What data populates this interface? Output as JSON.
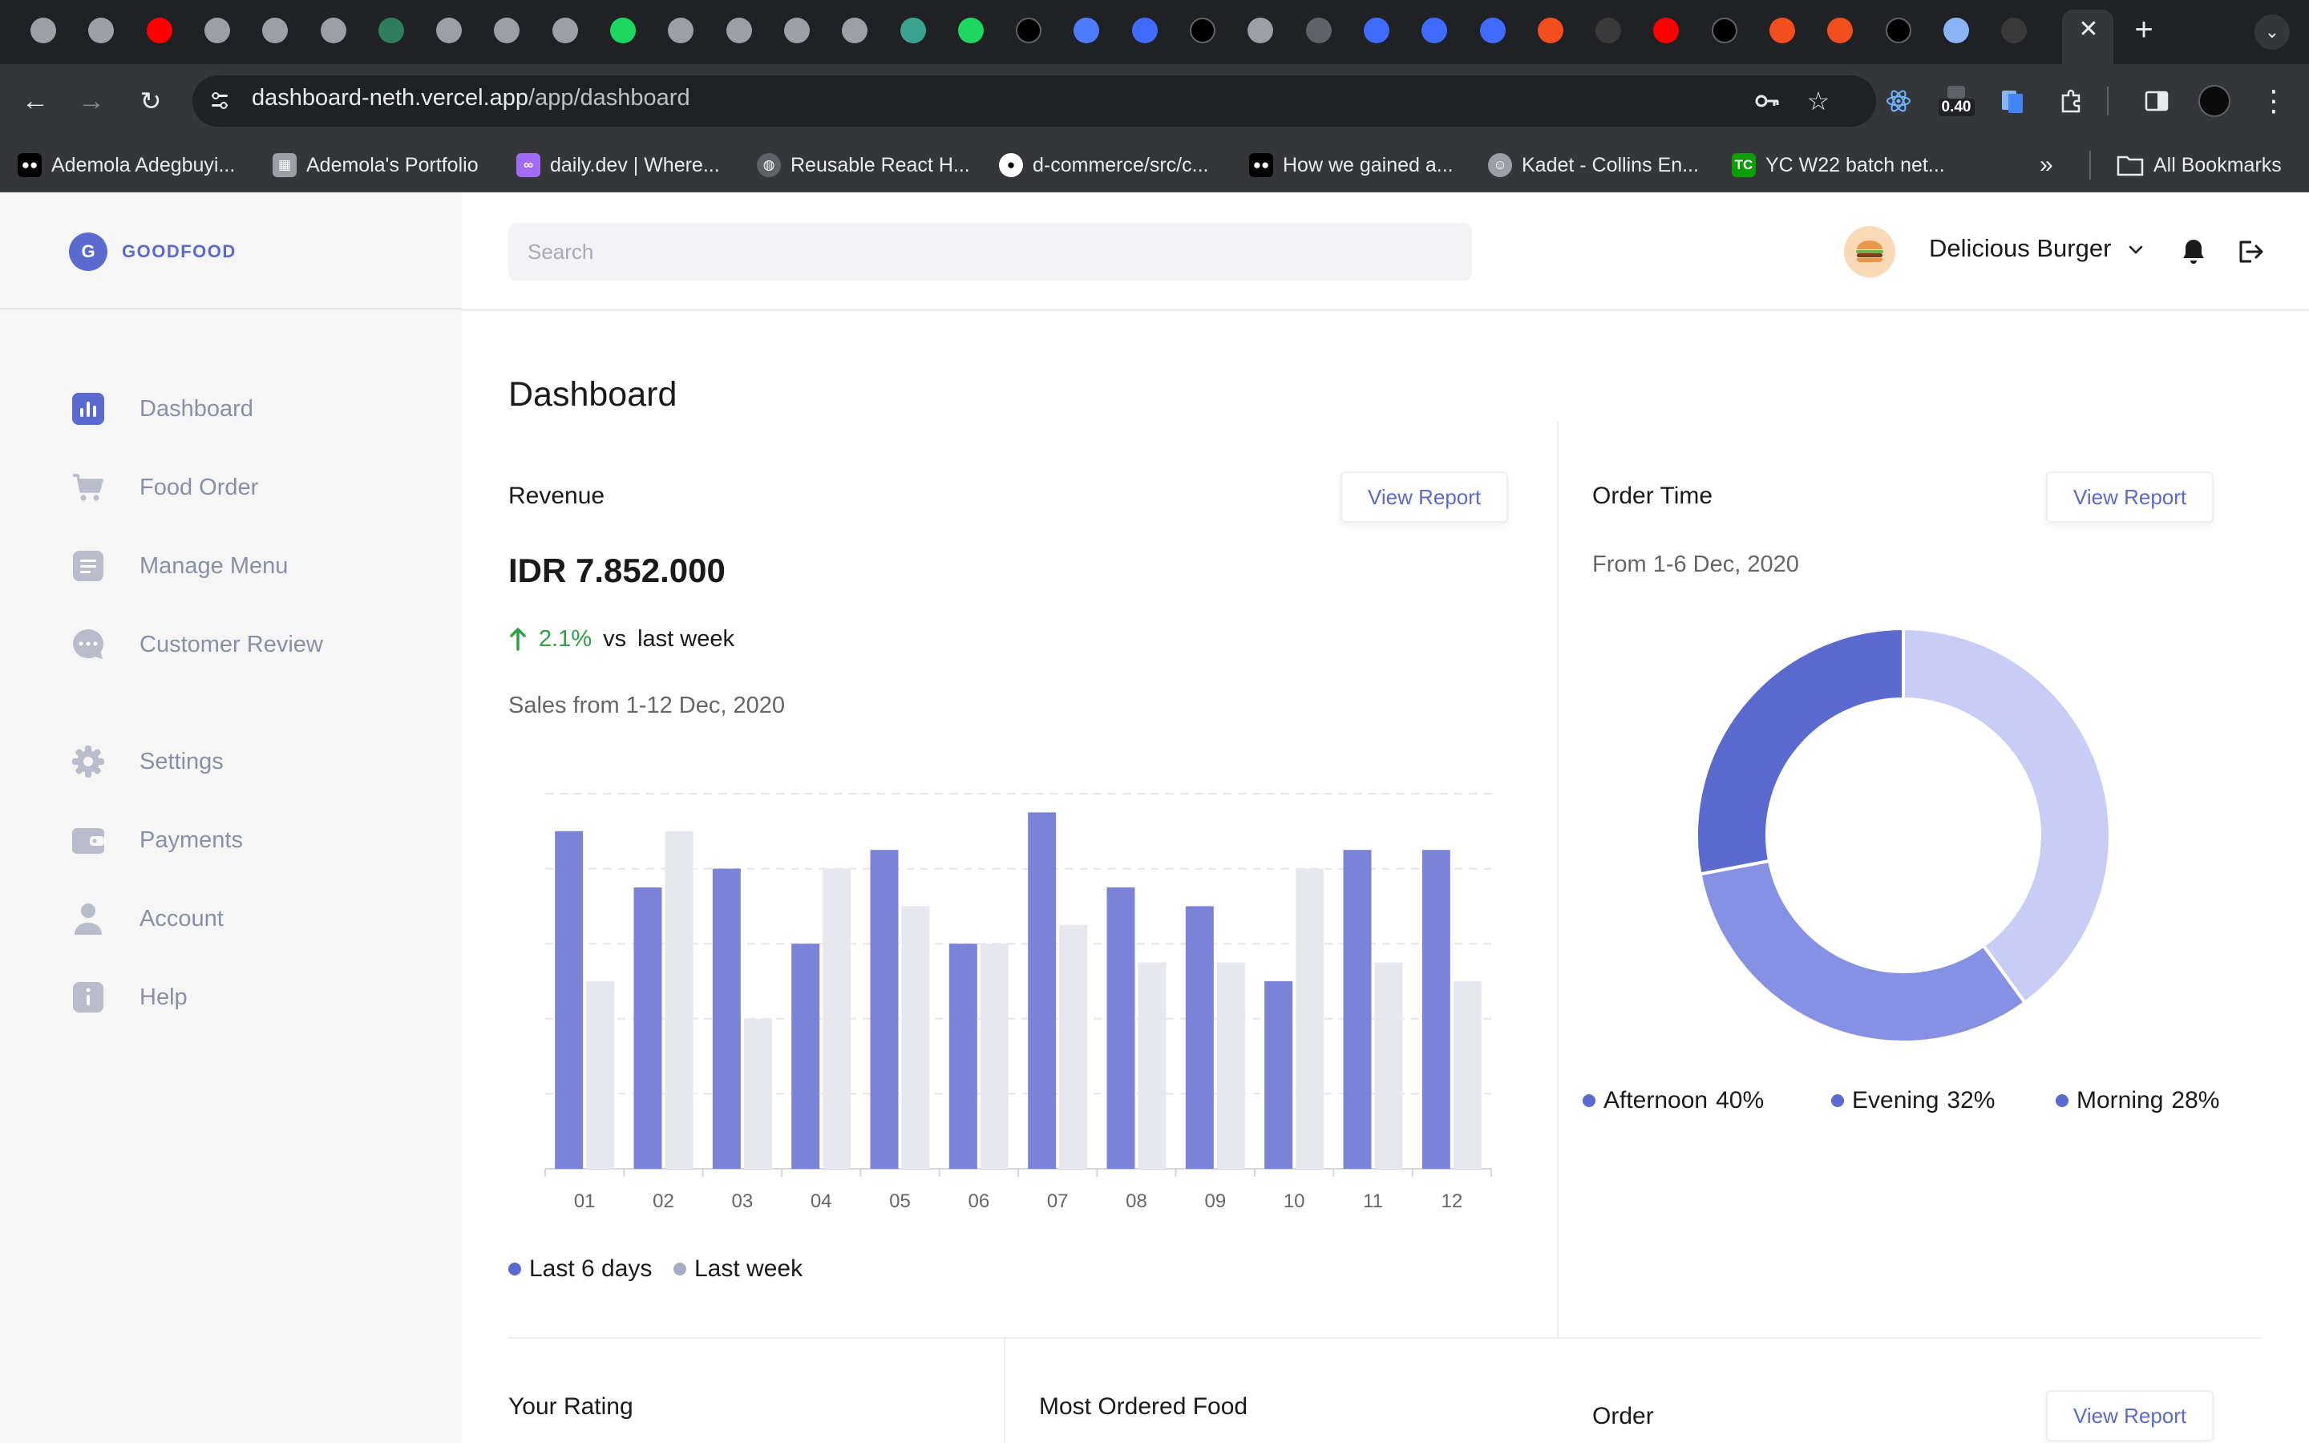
{
  "browser": {
    "url_host": "dashboard-neth.vercel.app",
    "url_path": "/app/dashboard",
    "extension_badge": "0.40",
    "bookmarks": [
      {
        "label": "Ademola Adegbuyi...",
        "icon": "medium-icon"
      },
      {
        "label": "Ademola's Portfolio",
        "icon": "portfolio-icon"
      },
      {
        "label": "daily.dev | Where...",
        "icon": "dailydev-icon"
      },
      {
        "label": "Reusable React H...",
        "icon": "globe-icon"
      },
      {
        "label": "d-commerce/src/c...",
        "icon": "github-icon"
      },
      {
        "label": "How we gained a...",
        "icon": "medium-icon"
      },
      {
        "label": "Kadet - Collins En...",
        "icon": "avatar-icon"
      },
      {
        "label": "YC W22 batch net...",
        "icon": "techcrunch-icon"
      }
    ],
    "all_bookmarks_label": "All Bookmarks"
  },
  "brand": {
    "logo_letter": "G",
    "name": "GOODFOOD"
  },
  "sidebar": {
    "items": [
      {
        "label": "Dashboard",
        "icon": "bar-chart-icon"
      },
      {
        "label": "Food Order",
        "icon": "cart-icon"
      },
      {
        "label": "Manage Menu",
        "icon": "document-icon"
      },
      {
        "label": "Customer Review",
        "icon": "chat-icon"
      },
      {
        "label": "Settings",
        "icon": "gear-icon"
      },
      {
        "label": "Payments",
        "icon": "wallet-icon"
      },
      {
        "label": "Account",
        "icon": "person-icon"
      },
      {
        "label": "Help",
        "icon": "info-icon"
      }
    ]
  },
  "header": {
    "search_placeholder": "Search",
    "user_name": "Delicious Burger"
  },
  "page": {
    "title": "Dashboard"
  },
  "revenue": {
    "title": "Revenue",
    "view_report": "View Report",
    "value": "IDR 7.852.000",
    "change_pct": "2.1%",
    "vs_label": "vs",
    "period_label": "last week",
    "subtitle": "Sales from 1-12 Dec, 2020"
  },
  "order_time": {
    "title": "Order Time",
    "view_report": "View Report",
    "subtitle": "From 1-6 Dec, 2020"
  },
  "bottom": {
    "rating_title": "Your Rating",
    "most_ordered_title": "Most Ordered Food",
    "order_title": "Order",
    "order_view_report": "View Report"
  },
  "colors": {
    "accent": "#5a6acf",
    "bar_primary": "#7b83d9",
    "bar_secondary": "#e7e7ee",
    "up": "#2fa044",
    "pie_afternoon": "#c8cdf6",
    "pie_evening": "#8791e4",
    "pie_morning": "#5a6acf"
  },
  "chart_data": [
    {
      "type": "bar",
      "categories": [
        "01",
        "02",
        "03",
        "04",
        "05",
        "06",
        "07",
        "08",
        "09",
        "10",
        "11",
        "12"
      ],
      "series": [
        {
          "name": "Last 6 days",
          "values": [
            9,
            7.5,
            8,
            6,
            8.5,
            6,
            9.5,
            7.5,
            7,
            5,
            8.5,
            8.5
          ]
        },
        {
          "name": "Last week",
          "values": [
            5,
            9,
            4,
            8,
            7,
            6,
            6.5,
            5.5,
            5.5,
            8,
            5.5,
            5
          ]
        }
      ],
      "ylim": [
        0,
        10
      ],
      "grid": true,
      "legend": "bottom-left"
    },
    {
      "type": "pie",
      "donut": true,
      "labels": [
        "Afternoon",
        "Evening",
        "Morning"
      ],
      "values": [
        40,
        32,
        28
      ],
      "value_labels": [
        "40%",
        "32%",
        "28%"
      ],
      "legend": "bottom"
    }
  ]
}
